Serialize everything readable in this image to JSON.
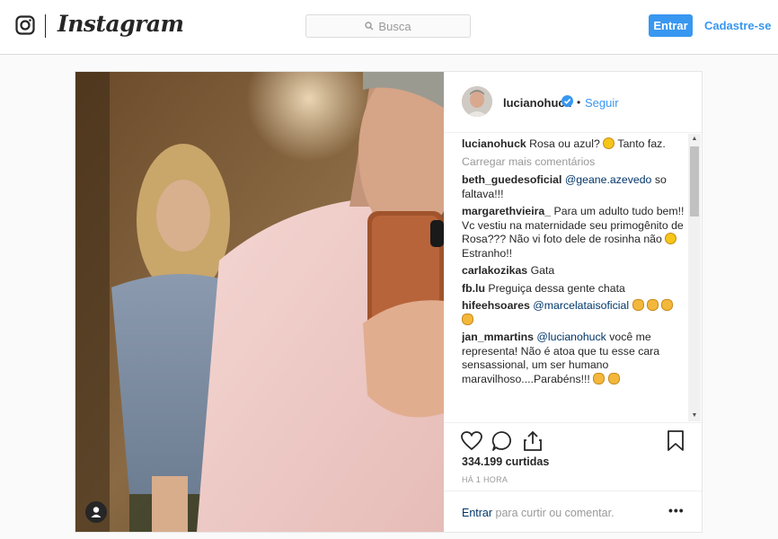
{
  "nav": {
    "brand": "Instagram",
    "search_placeholder": "Busca",
    "login_label": "Entrar",
    "signup_label": "Cadastre-se",
    "accent_color": "#3897f0"
  },
  "post": {
    "username": "lucianohuck",
    "verified": true,
    "dot": "•",
    "follow_label": "Seguir",
    "caption_user": "lucianohuck",
    "caption_text": "Rosa ou azul?",
    "caption_text_2": "Tanto faz.",
    "load_more": "Carregar mais comentários",
    "comments": [
      {
        "user": "beth_guedesoficial",
        "mention": "@geane.azevedo",
        "text": "so faltava!!!"
      },
      {
        "user": "margarethvieira_",
        "text": "Para um adulto tudo bem!! Vc vestiu na maternidade seu primogênito de Rosa??? Não vi foto dele de rosinha não",
        "text_2": "Estranho!!"
      },
      {
        "user": "carlakozikas",
        "text": "Gata"
      },
      {
        "user": "fb.lu",
        "text": "Preguiça dessa gente chata"
      },
      {
        "user": "hifeehsoares",
        "mention": "@marcelataisoficial",
        "text": ""
      },
      {
        "user": "jan_mmartins",
        "mention": "@lucianohuck",
        "text": "você me representa! Não é atoa que tu esse cara sensassional, um ser humano maravilhoso....Parabéns!!!"
      }
    ],
    "likes": "334.199 curtidas",
    "time_ago": "HÁ 1 HORA",
    "add_comment_link": "Entrar",
    "add_comment_text": "para curtir ou comentar.",
    "more_options": "•••"
  },
  "icons": [
    "instagram-glyph-icon",
    "search-icon",
    "verified-badge-icon",
    "heart-icon",
    "comment-icon",
    "share-icon",
    "bookmark-icon",
    "user-tag-icon"
  ]
}
